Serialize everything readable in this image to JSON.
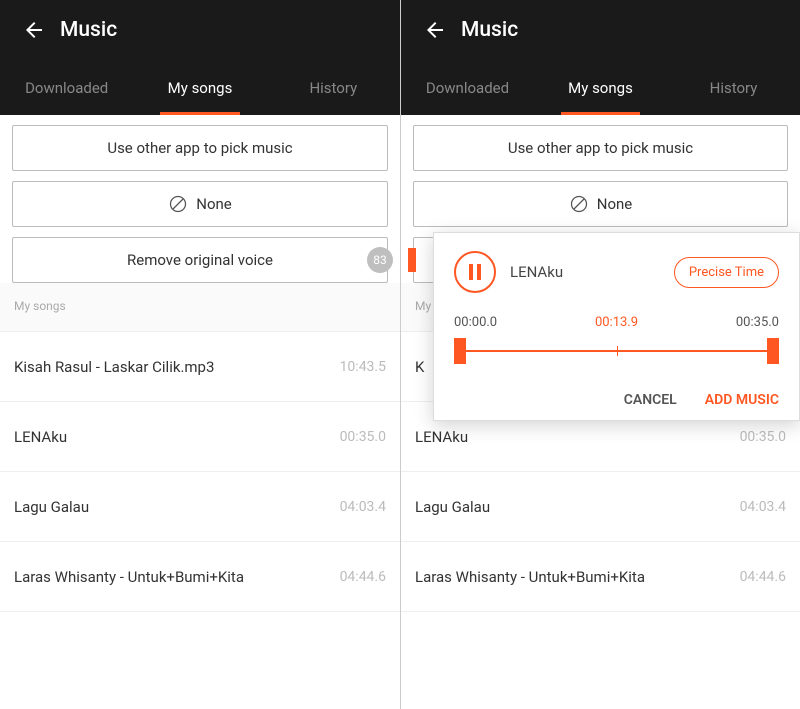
{
  "header": {
    "title": "Music"
  },
  "tabs": {
    "downloaded": "Downloaded",
    "my_songs": "My songs",
    "history": "History"
  },
  "buttons": {
    "pick_other": "Use other app to pick music",
    "none": "None",
    "remove_voice": "Remove original voice",
    "badge": "83"
  },
  "section": {
    "my_songs_label": "My songs",
    "my_songs_label_clipped": "My"
  },
  "songs": [
    {
      "title": "Kisah Rasul - Laskar Cilik.mp3",
      "duration": "10:43.5"
    },
    {
      "title": "LENAku",
      "duration": "00:35.0"
    },
    {
      "title": "Lagu Galau",
      "duration": "04:03.4"
    },
    {
      "title": "Laras Whisanty - Untuk+Bumi+Kita",
      "duration": "04:44.6"
    }
  ],
  "songs_right_visible": [
    {
      "title": "K",
      "duration": ""
    },
    {
      "title": "LENAku",
      "duration": "00:35.0"
    },
    {
      "title": "Lagu Galau",
      "duration": "04:03.4"
    },
    {
      "title": "Laras Whisanty - Untuk+Bumi+Kita",
      "duration": "04:44.6"
    }
  ],
  "popup": {
    "song": "LENAku",
    "precise": "Precise Time",
    "time_start": "00:00.0",
    "time_cur": "00:13.9",
    "time_end": "00:35.0",
    "cancel": "CANCEL",
    "add": "ADD MUSIC"
  }
}
